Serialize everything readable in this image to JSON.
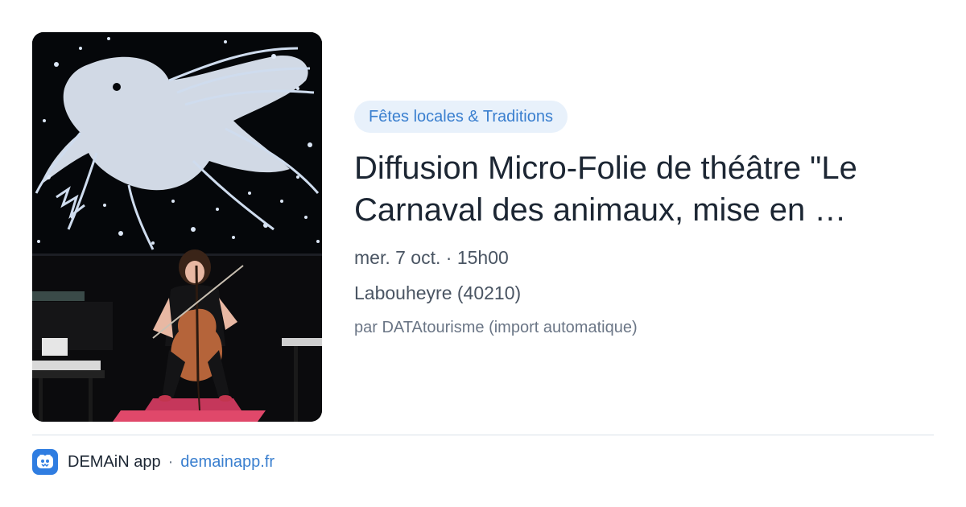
{
  "card": {
    "image_alt": "Cellist performing on stage in front of a projected drawing of a bird",
    "category": "Fêtes locales & Traditions",
    "title": "Diffusion Micro-Folie de théâtre \"Le Carnaval des animaux, mise en …",
    "date_time": "mer. 7 oct. · 15h00",
    "location": "Labouheyre (40210)",
    "source": "par DATAtourisme (import automatique)"
  },
  "footer": {
    "app_icon": "demain-app-icon",
    "app_name": "DEMAiN app",
    "separator": "·",
    "link_text": "demainapp.fr"
  },
  "colors": {
    "accent": "#3a7fcf",
    "badge_bg": "#e8f1fb",
    "title": "#1c2633",
    "muted": "#4a5563",
    "app_icon_bg": "#2f7de1"
  }
}
